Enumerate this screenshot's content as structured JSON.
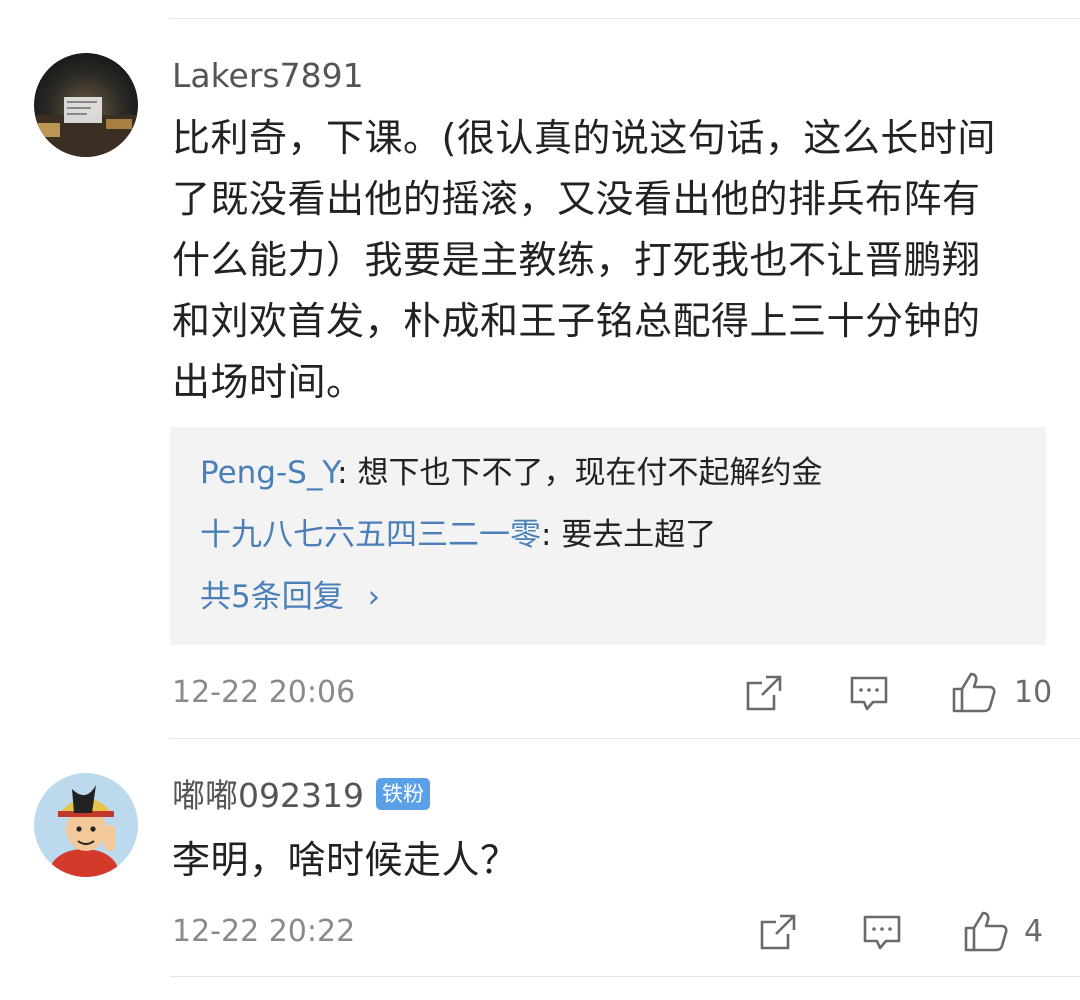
{
  "comments": [
    {
      "username": "Lakers7891",
      "text": "比利奇，下课。(很认真的说这句话，这么长时间了既没看出他的摇滚，又没看出他的排兵布阵有什么能力）我要是主教练，打死我也不让晋鹏翔和刘欢首发，朴成和王子铭总配得上三十分钟的出场时间。",
      "text_lines": [
        "比利奇，下课。(很认真的说这句话，这么长时间",
        "了既没看出他的摇滚，又没看出他的排兵布阵有",
        "什么能力）我要是主教练，打死我也不让晋鹏翔",
        "和刘欢首发，朴成和王子铭总配得上三十分钟的",
        "出场时间。"
      ],
      "replies": [
        {
          "author": "Peng-S_Y",
          "sep": ": ",
          "text": "想下也下不了，现在付不起解约金"
        },
        {
          "author": "十九八七六五四三二一零",
          "sep": ": ",
          "text": "要去土超了"
        }
      ],
      "more_replies_label": "共5条回复",
      "more_replies_arrow": "›",
      "timestamp": "12-22 20:06",
      "like_count": "10"
    },
    {
      "username": "嘟嘟092319",
      "badge": "铁粉",
      "text": "李明，啥时候走人？",
      "timestamp": "12-22 20:22",
      "like_count": "4"
    }
  ],
  "icons": {
    "share": "share-icon",
    "reply": "comment-icon",
    "like": "thumbs-up-icon"
  },
  "colors": {
    "link": "#4a7fb8",
    "badge": "#5aa0e6",
    "meta": "#8a8a8a",
    "reply_bg": "#f3f3f3"
  }
}
